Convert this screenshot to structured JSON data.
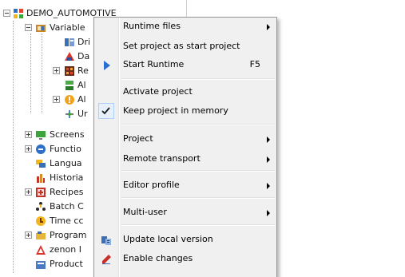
{
  "tree": {
    "root_label": "DEMO_AUTOMOTIVE",
    "items": [
      {
        "label": "Variable",
        "icon": "variables-folder-icon"
      },
      {
        "label": "Dri",
        "icon": "drivers-icon"
      },
      {
        "label": "Da",
        "icon": "datatypes-icon"
      },
      {
        "label": "Re",
        "icon": "reaction-matrix-icon"
      },
      {
        "label": "Al",
        "icon": "allocation-icon"
      },
      {
        "label": "Al",
        "icon": "alarm-icon"
      },
      {
        "label": "Ur",
        "icon": "units-icon"
      },
      {
        "label": "Screens",
        "icon": "screens-icon"
      },
      {
        "label": "Functio",
        "icon": "functions-icon"
      },
      {
        "label": "Langua",
        "icon": "language-icon"
      },
      {
        "label": "Historia",
        "icon": "historian-icon"
      },
      {
        "label": "Recipes",
        "icon": "recipes-icon"
      },
      {
        "label": "Batch C",
        "icon": "batch-control-icon"
      },
      {
        "label": "Time cc",
        "icon": "time-control-icon"
      },
      {
        "label": "Program",
        "icon": "programming-icon"
      },
      {
        "label": "zenon I",
        "icon": "zenon-logic-icon"
      },
      {
        "label": "Product",
        "icon": "production-icon"
      }
    ]
  },
  "menu": {
    "items": [
      {
        "label": "Runtime files",
        "submenu": true
      },
      {
        "label": "Set project as start project"
      },
      {
        "label": "Start Runtime",
        "shortcut": "F5",
        "icon": "play-icon"
      },
      {
        "label": "Activate project"
      },
      {
        "label": "Keep project in memory",
        "checked": true
      },
      {
        "label": "Project",
        "submenu": true
      },
      {
        "label": "Remote transport",
        "submenu": true
      },
      {
        "label": "Editor profile",
        "submenu": true
      },
      {
        "label": "Multi-user",
        "submenu": true
      },
      {
        "label": "Update local version",
        "icon": "update-local-version-icon"
      },
      {
        "label": "Enable changes",
        "icon": "enable-changes-icon"
      }
    ]
  },
  "colors": {
    "menu_bg": "#f0f0f0",
    "check_highlight": "#e6f0fa",
    "play_arrow": "#2a6fd0"
  }
}
